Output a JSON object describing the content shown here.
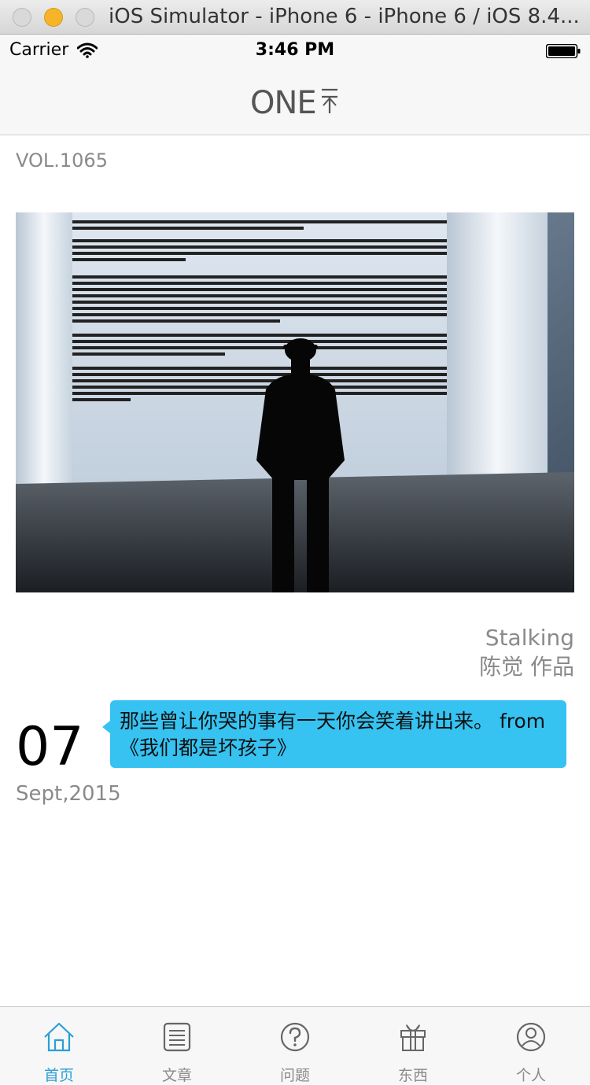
{
  "window": {
    "title": "iOS Simulator - iPhone 6 - iPhone 6 / iOS 8.4..."
  },
  "statusbar": {
    "carrier": "Carrier",
    "time": "3:46 PM"
  },
  "navbar": {
    "logo": "ONE"
  },
  "content": {
    "vol": "VOL.1065",
    "photo_title": "Stalking",
    "photo_author": "陈觉 作品",
    "day": "07",
    "month_year": "Sept,2015",
    "quote": "那些曾让你哭的事有一天你会笑着讲出来。 from 《我们都是坏孩子》"
  },
  "tabbar": {
    "items": [
      {
        "label": "首页",
        "icon": "home-icon",
        "active": true
      },
      {
        "label": "文章",
        "icon": "document-icon",
        "active": false
      },
      {
        "label": "问题",
        "icon": "question-icon",
        "active": false
      },
      {
        "label": "东西",
        "icon": "gift-icon",
        "active": false
      },
      {
        "label": "个人",
        "icon": "person-icon",
        "active": false
      }
    ]
  },
  "colors": {
    "accent": "#2a9fd6",
    "quote_bg": "#36c3f2",
    "muted_text": "#8a8a8a"
  }
}
